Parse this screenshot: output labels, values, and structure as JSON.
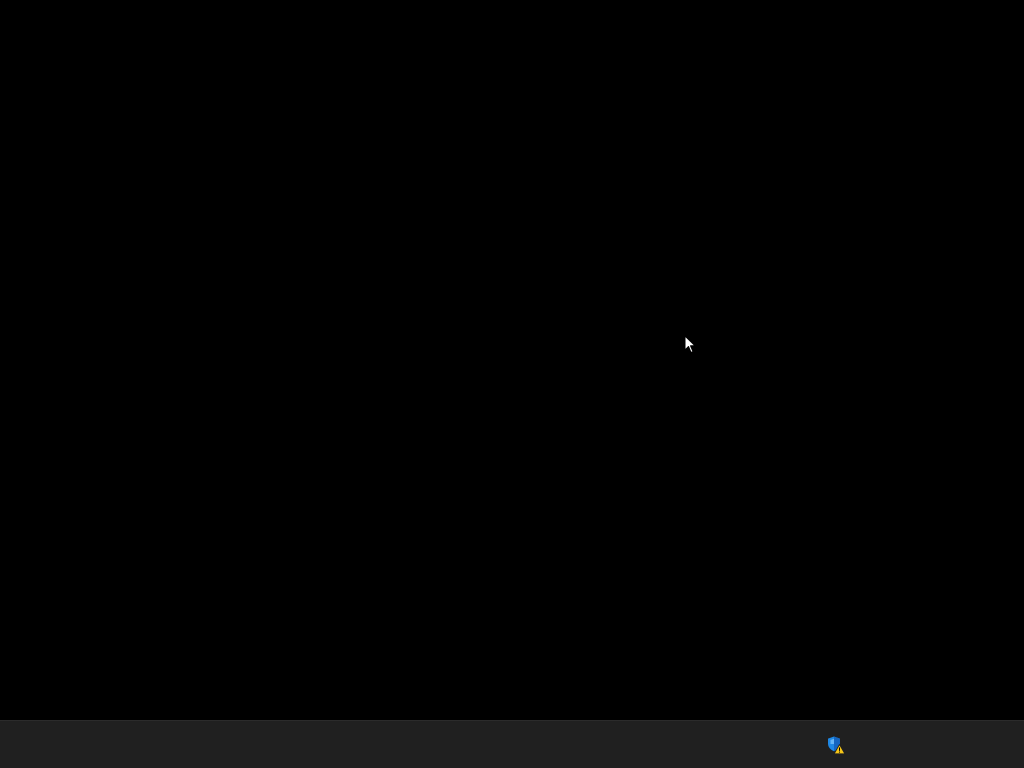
{
  "desktop": {
    "background_color": "#000000"
  },
  "cursor": {
    "icon": "arrow-pointer-icon",
    "color": "#ffffff"
  },
  "taskbar": {
    "background_color": "#202020",
    "tray": {
      "items": [
        {
          "icon": "security-shield-warning-icon",
          "shield_color": "#1e88e5",
          "warning_color": "#f5c518"
        }
      ]
    }
  }
}
